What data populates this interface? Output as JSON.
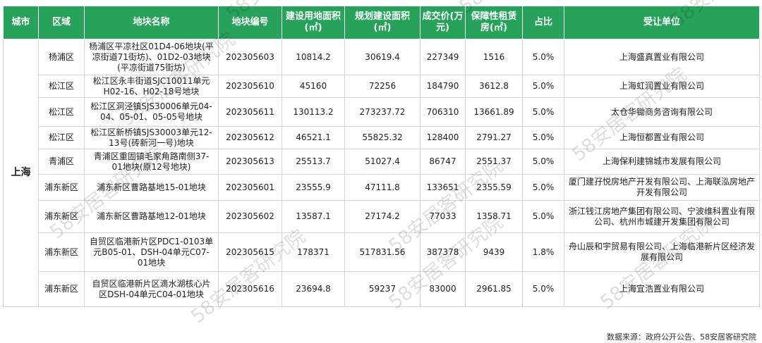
{
  "headers": [
    "城市",
    "区域",
    "地块名称",
    "地块编号",
    "建设用地面积(㎡)",
    "规划建设面积(㎡)",
    "成交价(万元)",
    "保障性租赁房(㎡)",
    "占比",
    "受让单位"
  ],
  "header_lines": [
    [
      "城市"
    ],
    [
      "区域"
    ],
    [
      "地块名称"
    ],
    [
      "地块编号"
    ],
    [
      "建设用地面积",
      "(㎡)"
    ],
    [
      "规划建设面积",
      "(㎡)"
    ],
    [
      "成交价(万",
      "元)"
    ],
    [
      "保障性租赁",
      "房(㎡)"
    ],
    [
      "占比"
    ],
    [
      "受让单位"
    ]
  ],
  "city": "上海",
  "rows": [
    {
      "area": "杨浦区",
      "name": "杨浦区平凉社区01D4-06地块(平凉街道71街坊)、01D2-03地块(平凉街道75街坊)",
      "code": "202305603",
      "land": "10814.2",
      "build": "30619.4",
      "price": "227349",
      "rent": "1516",
      "pct": "5.0%",
      "buyer": "上海盛真置业有限公司"
    },
    {
      "area": "松江区",
      "name": "松江区永丰街道SJC10011单元H02-16、H02-18号地块",
      "code": "202305610",
      "land": "45160",
      "build": "72256",
      "price": "184790",
      "rent": "3612.8",
      "pct": "5.0%",
      "buyer": "上海虹润置业有限公司"
    },
    {
      "area": "松江区",
      "name": "松江区洞泾镇SJS30006单元04-04、05-01、05-05号地块",
      "code": "202305611",
      "land": "130113.2",
      "build": "273237.72",
      "price": "706310",
      "rent": "13661.89",
      "pct": "5.0%",
      "buyer": "太仓华锄商务咨询有限公司"
    },
    {
      "area": "松江区",
      "name": "松江区新桥镇SJS30003单元12-13号(砖新河一号)地块",
      "code": "202305612",
      "land": "46521.1",
      "build": "55825.32",
      "price": "128400",
      "rent": "2791.27",
      "pct": "5.0%",
      "buyer": "上海恒都置业有限公司"
    },
    {
      "area": "青浦区",
      "name": "青浦区重固镇毛家角路南侧37-01地块(原12号地块)",
      "code": "202305613",
      "land": "25513.7",
      "build": "51027.4",
      "price": "86747",
      "rent": "2551.37",
      "pct": "5.0%",
      "buyer": "上海保利建锦城市发展有限公司"
    },
    {
      "area": "浦东新区",
      "name": "浦东新区曹路基地15-01地块",
      "code": "202305601",
      "land": "23555.9",
      "build": "47111.8",
      "price": "133651",
      "rent": "2355.59",
      "pct": "5.0%",
      "buyer": "厦门建孖悦房地产开发有限公司、上海联泓房地产开发有限公司"
    },
    {
      "area": "浦东新区",
      "name": "浦东新区曹路基地12-01地块",
      "code": "202305602",
      "land": "13587.1",
      "build": "27174.2",
      "price": "77033",
      "rent": "1358.71",
      "pct": "5.0%",
      "buyer": "浙江钱江房地产集团有限公司、宁波维科置业有限公司、杭州市城建开发集团有限公司"
    },
    {
      "area": "浦东新区",
      "name": "自贸区临港新片区PDC1-0103单元B05-01、DSH-04单元C07-01地块",
      "code": "202305615",
      "land": "178371",
      "build": "517831.56",
      "price": "387378",
      "rent": "9439",
      "pct": "1.8%",
      "buyer": "舟山辰和宇贸易有限公司、上海临港新片区经济发展有限公司"
    },
    {
      "area": "浦东新区",
      "name": "自贸区临港新片区滴水湖核心片区DSH-04单元C04-01地块",
      "code": "202305616",
      "land": "23694.8",
      "build": "59237",
      "price": "83000",
      "rent": "2961.85",
      "pct": "5.0%",
      "buyer": "上海宜浩置业有限公司"
    }
  ],
  "footer": "数据来源：政府公开公告、58安居客研究院",
  "watermark": "58安居客研究院",
  "colors": {
    "header_bg": "#26a25a",
    "header_text": "#ffffff",
    "border": "#d6d6d6"
  }
}
